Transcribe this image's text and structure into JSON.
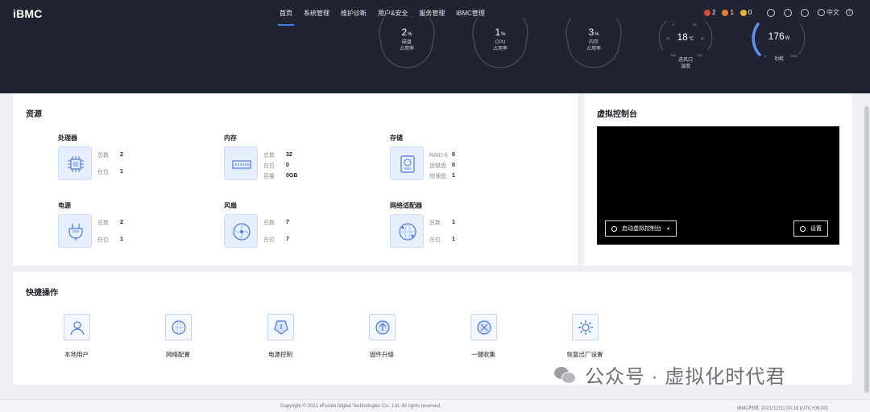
{
  "header": {
    "brand": "iBMC",
    "nav": [
      "首页",
      "系统管理",
      "维护诊断",
      "用户&安全",
      "服务管理",
      "iBMC管理"
    ],
    "alarms": [
      {
        "icon": "alarm-critical-icon",
        "count": "2",
        "color": "#e0463a"
      },
      {
        "icon": "alarm-major-icon",
        "count": "1",
        "color": "#ee7d2a"
      },
      {
        "icon": "alarm-minor-icon",
        "count": "0",
        "color": "#e8b531"
      }
    ],
    "tools": [
      "power-icon",
      "uid-icon",
      "user-icon"
    ],
    "language": "中文",
    "help": "?"
  },
  "gauges": [
    {
      "value": "2",
      "unit": "%",
      "label1": "磁盘",
      "label2": "占用率",
      "percent": 2
    },
    {
      "value": "1",
      "unit": "%",
      "label1": "CPU",
      "label2": "占用率",
      "percent": 1
    },
    {
      "value": "3",
      "unit": "%",
      "label1": "内存",
      "label2": "占用率",
      "percent": 3
    },
    {
      "value": "18",
      "unit": "℃",
      "label1": "进风口",
      "label2": "温度",
      "scale": [
        "-40",
        "0",
        "40",
        "80",
        "-100",
        "120"
      ]
    },
    {
      "value": "176",
      "unit": "W",
      "label1": "功耗",
      "label2": "",
      "scale": [
        "0",
        "2000"
      ]
    }
  ],
  "resources": {
    "title": "资源",
    "groups": [
      {
        "name": "处理器",
        "icon": "cpu-icon",
        "rows": [
          [
            "总数",
            "2"
          ],
          [
            "在位",
            "1"
          ]
        ]
      },
      {
        "name": "内存",
        "icon": "memory-icon",
        "rows": [
          [
            "总数",
            "32"
          ],
          [
            "在位",
            "0"
          ],
          [
            "容量",
            "0GB"
          ]
        ]
      },
      {
        "name": "存储",
        "icon": "storage-icon",
        "rows": [
          [
            "RAID卡",
            "0"
          ],
          [
            "逻辑盘",
            "0"
          ],
          [
            "物理盘",
            "1"
          ]
        ]
      },
      {
        "name": "电源",
        "icon": "power-supply-icon",
        "rows": [
          [
            "总数",
            "2"
          ],
          [
            "在位",
            "1"
          ]
        ]
      },
      {
        "name": "风扇",
        "icon": "fan-icon",
        "rows": [
          [
            "总数",
            "7"
          ],
          [
            "在位",
            "7"
          ]
        ]
      },
      {
        "name": "网络适配器",
        "icon": "network-adapter-icon",
        "rows": [
          [
            "总数",
            "1"
          ],
          [
            "在位",
            "1"
          ]
        ]
      }
    ]
  },
  "console": {
    "title": "虚拟控制台",
    "launch_label": "启动虚拟控制台",
    "settings_label": "设置"
  },
  "quick": {
    "title": "快捷操作",
    "items": [
      {
        "label": "本地用户",
        "icon": "local-user-icon"
      },
      {
        "label": "网络配置",
        "icon": "network-config-icon"
      },
      {
        "label": "电源控制",
        "icon": "power-control-icon"
      },
      {
        "label": "固件升级",
        "icon": "firmware-upgrade-icon"
      },
      {
        "label": "一键收集",
        "icon": "one-click-collect-icon"
      },
      {
        "label": "恢复出厂设置",
        "icon": "factory-reset-icon"
      }
    ]
  },
  "footer": {
    "copyright": "Copyright © 2021 xFusion Digital Technologies Co., Ltd. All rights reserved.",
    "time": "iBMC时间:   2021/12/11 00:18 (UTC+08:00)"
  },
  "watermark": "公众号 · 虚拟化时代君",
  "colors": {
    "accent": "#3f7bff",
    "topbar": "#1f2430",
    "gauge_power": "#5b8ff9"
  }
}
